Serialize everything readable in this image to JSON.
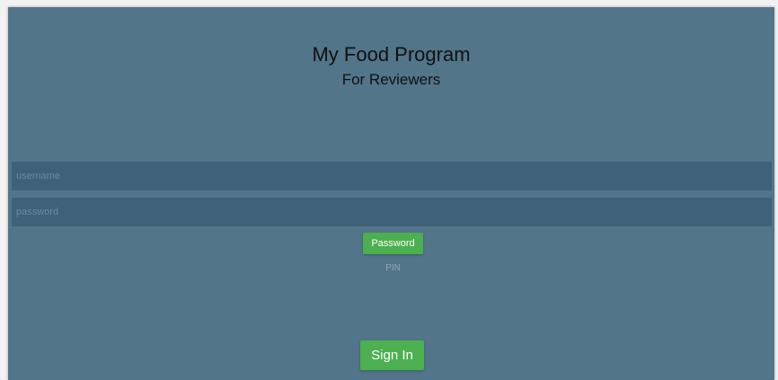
{
  "app": {
    "title": "My Food Program",
    "subtitle": "For Reviewers"
  },
  "form": {
    "username_placeholder": "username",
    "username_value": "",
    "password_placeholder": "password",
    "password_value": ""
  },
  "auth_mode": {
    "selected_label": "Password",
    "alternate_label": "PIN"
  },
  "actions": {
    "signin_label": "Sign In"
  },
  "colors": {
    "background": "#527589",
    "field_background": "#3f6278",
    "accent": "#4caf50"
  }
}
